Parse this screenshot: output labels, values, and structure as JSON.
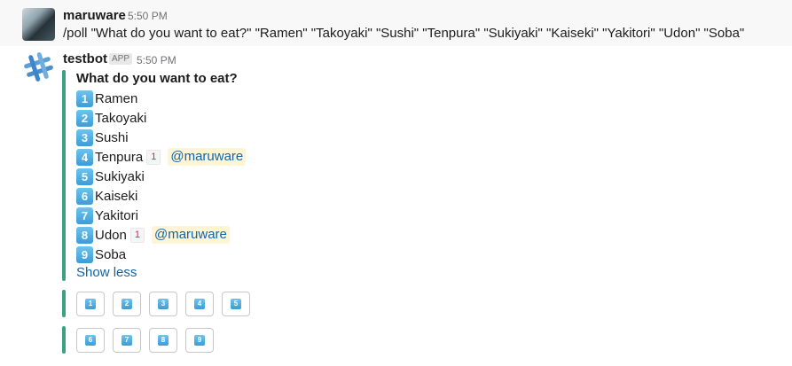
{
  "messages": [
    {
      "author": "maruware",
      "time": "5:50 PM",
      "text": "/poll \"What do you want to eat?\" \"Ramen\" \"Takoyaki\" \"Sushi\" \"Tenpura\" \"Sukiyaki\" \"Kaiseki\" \"Yakitori\" \"Udon\" \"Soba\""
    },
    {
      "author": "testbot",
      "badge": "APP",
      "time": "5:50 PM",
      "attachment": {
        "title": "What do you want to eat?",
        "options": [
          {
            "key": "1",
            "label": "Ramen"
          },
          {
            "key": "2",
            "label": "Takoyaki"
          },
          {
            "key": "3",
            "label": "Sushi"
          },
          {
            "key": "4",
            "label": "Tenpura",
            "count": "1",
            "voter": "@maruware"
          },
          {
            "key": "5",
            "label": "Sukiyaki"
          },
          {
            "key": "6",
            "label": "Kaiseki"
          },
          {
            "key": "7",
            "label": "Yakitori"
          },
          {
            "key": "8",
            "label": "Udon",
            "count": "1",
            "voter": "@maruware"
          },
          {
            "key": "9",
            "label": "Soba"
          }
        ],
        "toggle_label": "Show less"
      },
      "vote_buttons": [
        [
          "1",
          "2",
          "3",
          "4",
          "5"
        ],
        [
          "6",
          "7",
          "8",
          "9"
        ]
      ]
    }
  ],
  "colors": {
    "attachment_bar": "#3aa37e",
    "link": "#1264a3",
    "mention_bg": "#fff5d6",
    "keycap": "#3d9cd4",
    "count": "#e01e5a"
  },
  "icons": {
    "bot_avatar": "slack-hash-icon",
    "keycap": "keycap-digit-icon"
  }
}
